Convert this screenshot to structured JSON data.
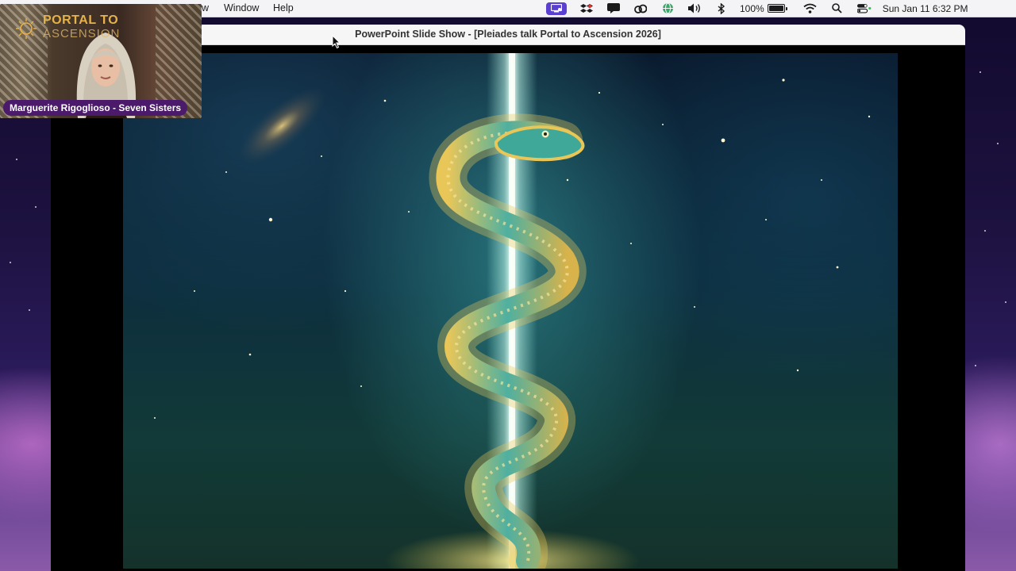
{
  "menubar": {
    "items": [
      {
        "label": "w"
      },
      {
        "label": "Window"
      },
      {
        "label": "Help"
      }
    ],
    "status": {
      "battery_percent": "100%",
      "datetime": "Sun Jan 11  6:32 PM"
    }
  },
  "window": {
    "title": "PowerPoint Slide Show - [Pleiades talk Portal to Ascension 2026]"
  },
  "webcam": {
    "logo_line1": "PORTAL TO",
    "logo_line2": "ASCENSION",
    "participant_name": "Marguerite Rigoglioso - Seven Sisters"
  },
  "colors": {
    "menubar_bg": "#f4f4f6",
    "active_status_icon": "#5b3fd1",
    "nameplate_bg": "#4c1a6a",
    "serpent_gold": "#d8b24a",
    "serpent_teal": "#4fb0a0",
    "light_beam": "#dffaf0"
  },
  "icons": {
    "screen_share": "screen-share-icon",
    "dropbox": "dropbox-icon",
    "messages": "message-icon",
    "creative_cloud": "creative-cloud-icon",
    "browser": "globe-icon",
    "volume": "speaker-icon",
    "bluetooth": "bluetooth-icon",
    "wifi": "wifi-icon",
    "search": "search-icon",
    "control_center": "control-center-icon"
  }
}
